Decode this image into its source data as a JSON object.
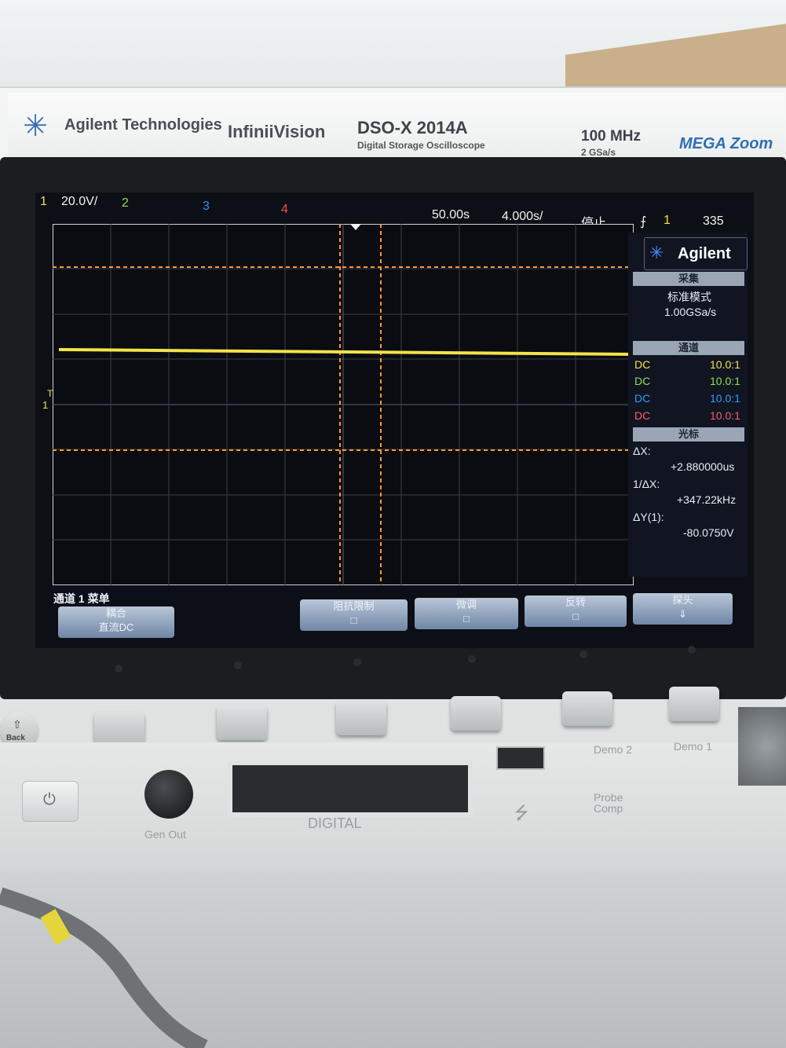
{
  "header": {
    "brand": "Agilent Technologies",
    "product": "InfiniiVision",
    "model": "DSO-X 2014A",
    "model_sub": "Digital Storage Oscilloscope",
    "bandwidth": "100 MHz",
    "sample_rate": "2 GSa/s",
    "mega": "MEGA Zoom"
  },
  "screen": {
    "ch1_label": "1",
    "ch1_scale": "20.0V/",
    "ch2_label": "2",
    "ch3_label": "3",
    "ch4_label": "4",
    "time_pos": "50.00s",
    "time_scale": "4.000s/",
    "run_state": "停止",
    "trig_source": "1",
    "trig_level": "335",
    "trig_marker": "T",
    "ch1_marker": "1",
    "colors": {
      "ch1": "#f2e34a",
      "ch2": "#8ee04b",
      "ch3": "#2f8cff",
      "ch4": "#ff4a4a",
      "cursor": "#ff9a2a"
    }
  },
  "panel": {
    "brand": "Agilent",
    "acq_header": "采集",
    "acq_mode": "标准模式",
    "acq_rate": "1.00GSa/s",
    "chan_header": "通道",
    "channels": [
      {
        "coupling": "DC",
        "probe": "10.0:1"
      },
      {
        "coupling": "DC",
        "probe": "10.0:1"
      },
      {
        "coupling": "DC",
        "probe": "10.0:1"
      },
      {
        "coupling": "DC",
        "probe": "10.0:1"
      }
    ],
    "cursor_header": "光标",
    "dx_label": "ΔX:",
    "dx_value": "+2.880000us",
    "inv_dx_label": "1/ΔX:",
    "inv_dx_value": "+347.22kHz",
    "dy_label": "ΔY(1):",
    "dy_value": "-80.0750V"
  },
  "menu": {
    "title": "通道 1 菜单",
    "softkeys": [
      {
        "top": "耦合",
        "bottom": "直流DC"
      },
      {
        "top": "阻抗限制",
        "bottom": "□"
      },
      {
        "top": "微调",
        "bottom": "□"
      },
      {
        "top": "反转",
        "bottom": "□"
      },
      {
        "top": "探头",
        "bottom": "⇓"
      }
    ]
  },
  "front": {
    "back_label": "Back",
    "digital_label": "DIGITAL",
    "gen_out_label": "Gen Out",
    "demo2_label": "Demo 2",
    "demo1_label": "Demo 1",
    "probe_comp_label": "Probe Comp"
  }
}
